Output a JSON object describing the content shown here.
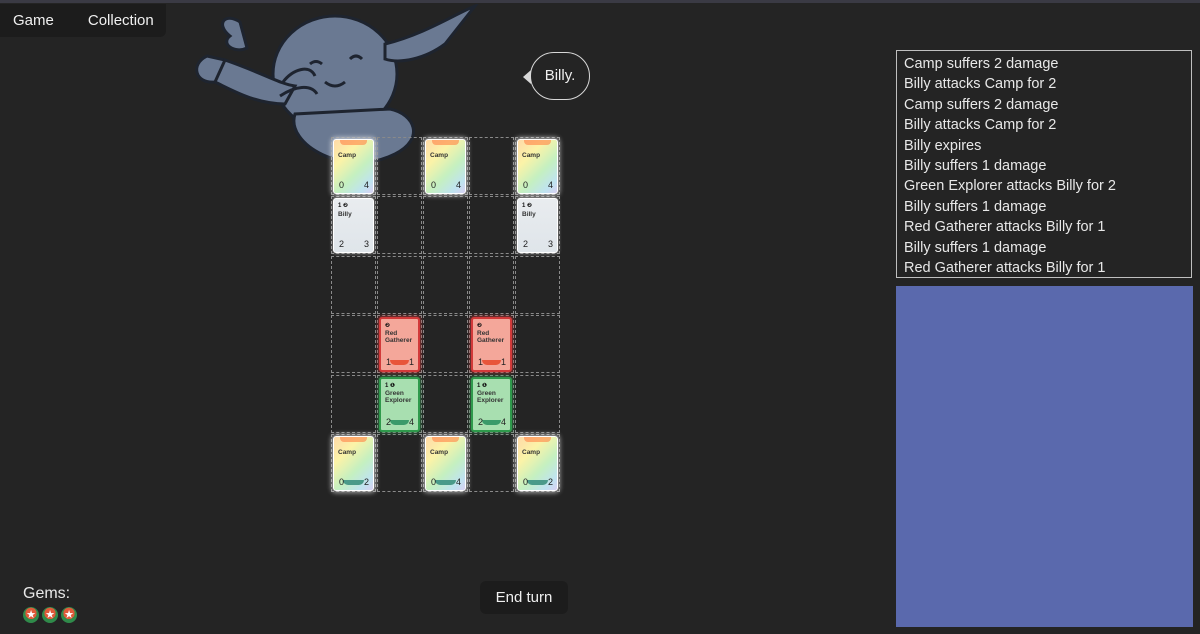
{
  "nav": {
    "game_label": "Game",
    "collection_label": "Collection"
  },
  "speech_bubble": {
    "text": "Billy."
  },
  "board": {
    "rows": 6,
    "cols": 5,
    "cards": [
      {
        "row": 0,
        "col": 0,
        "name": "Camp",
        "kind": "camp",
        "attack": "0",
        "health": "4",
        "cost": ""
      },
      {
        "row": 0,
        "col": 2,
        "name": "Camp",
        "kind": "camp",
        "attack": "0",
        "health": "4",
        "cost": ""
      },
      {
        "row": 0,
        "col": 4,
        "name": "Camp",
        "kind": "camp",
        "attack": "0",
        "health": "4",
        "cost": ""
      },
      {
        "row": 1,
        "col": 0,
        "name": "Billy",
        "kind": "billy",
        "attack": "2",
        "health": "3",
        "cost": "1 ❷"
      },
      {
        "row": 1,
        "col": 4,
        "name": "Billy",
        "kind": "billy",
        "attack": "2",
        "health": "3",
        "cost": "1 ❷"
      },
      {
        "row": 3,
        "col": 1,
        "name": "Red Gatherer",
        "kind": "red",
        "attack": "1",
        "health": "1",
        "cost": "❷"
      },
      {
        "row": 3,
        "col": 3,
        "name": "Red Gatherer",
        "kind": "red",
        "attack": "1",
        "health": "1",
        "cost": "❷"
      },
      {
        "row": 4,
        "col": 1,
        "name": "Green Explorer",
        "kind": "green",
        "attack": "2",
        "health": "4",
        "cost": "1 ❶"
      },
      {
        "row": 4,
        "col": 3,
        "name": "Green Explorer",
        "kind": "green",
        "attack": "2",
        "health": "4",
        "cost": "1 ❶"
      },
      {
        "row": 5,
        "col": 0,
        "name": "Camp",
        "kind": "camp",
        "attack": "0",
        "health": "2",
        "cost": ""
      },
      {
        "row": 5,
        "col": 2,
        "name": "Camp",
        "kind": "camp",
        "attack": "0",
        "health": "4",
        "cost": ""
      },
      {
        "row": 5,
        "col": 4,
        "name": "Camp",
        "kind": "camp",
        "attack": "0",
        "health": "2",
        "cost": ""
      }
    ]
  },
  "log": {
    "lines": [
      "Camp suffers 2 damage",
      "Billy attacks Camp for 2",
      "Camp suffers 2 damage",
      "Billy attacks Camp for 2",
      "Billy expires",
      "Billy suffers 1 damage",
      "Green Explorer attacks Billy for 2",
      "Billy suffers 1 damage",
      "Red Gatherer attacks Billy for 1",
      "Billy suffers 1 damage",
      "Red Gatherer attacks Billy for 1"
    ]
  },
  "panel": {
    "color": "#5a69ad"
  },
  "gems": {
    "label": "Gems:",
    "count": 3,
    "icon": "star-gem-icon"
  },
  "end_turn": {
    "label": "End turn"
  },
  "colors": {
    "background": "#242424",
    "red_border": "#d23a3a",
    "green_border": "#2f9a4c"
  }
}
